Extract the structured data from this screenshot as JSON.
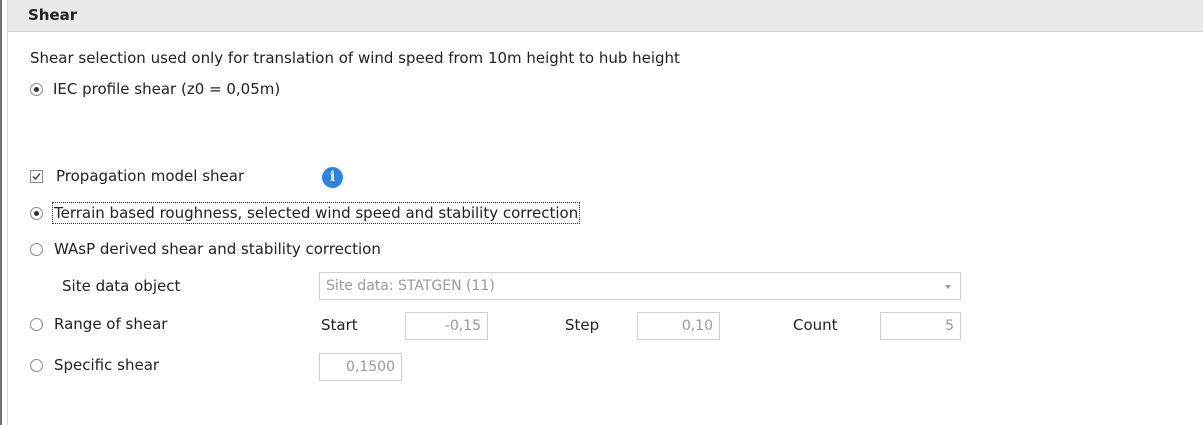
{
  "panel": {
    "title": "Shear"
  },
  "intro_text": "Shear selection used only for translation of wind speed from 10m height to hub height",
  "iec_option": {
    "label": "IEC profile shear (z0 = 0,05m)",
    "selected": true
  },
  "propagation": {
    "checkbox_label": "Propagation model shear",
    "checked": true,
    "info_icon": "info-icon",
    "options": {
      "terrain": {
        "label": "Terrain based roughness, selected wind speed and stability correction",
        "selected": true
      },
      "wasp": {
        "label": "WAsP derived shear and stability correction",
        "selected": false
      },
      "range": {
        "label": "Range of shear",
        "selected": false
      },
      "specific": {
        "label": "Specific shear",
        "selected": false
      }
    }
  },
  "site_data": {
    "label": "Site data object",
    "value": "Site data: STATGEN (11)"
  },
  "range_fields": {
    "start_label": "Start",
    "start_value": "-0,15",
    "step_label": "Step",
    "step_value": "0,10",
    "count_label": "Count",
    "count_value": "5"
  },
  "specific_value": "0,1500",
  "colors": {
    "info_icon": "#2a86e6",
    "header_bg": "#e9e9e9"
  }
}
